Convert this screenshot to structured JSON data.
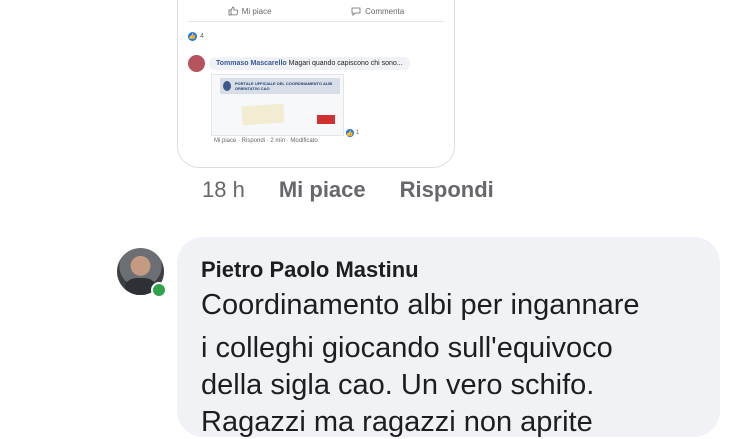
{
  "embedded_screenshot": {
    "actions": {
      "like_label": "Mi piace",
      "comment_label": "Commenta"
    },
    "reactions_count": "4",
    "comment": {
      "author": "Tommaso Mascarello",
      "text": "Magari quando capiscono chi sono..."
    },
    "banner_text": "PORTALE UFFICIALE DEL COORDINAMENTO ALBI ORIENTATIVI CAO",
    "meta": "Mi piace · Rispondi · 2 min · Modificato",
    "likes_count": "1"
  },
  "comment_meta": {
    "time": "18 h",
    "like_label": "Mi piace",
    "reply_label": "Rispondi"
  },
  "comment": {
    "author": "Pietro Paolo Mastinu",
    "lines": [
      "Coordinamento albi per ingannare",
      "i colleghi giocando sull'equivoco",
      "della sigla cao. Un vero schifo.",
      "Ragazzi ma ragazzi non aprite"
    ]
  },
  "colors": {
    "link_gray": "#65676b",
    "bubble": "#f0f2f5",
    "online": "#31a24c",
    "accent": "#1877f2"
  }
}
